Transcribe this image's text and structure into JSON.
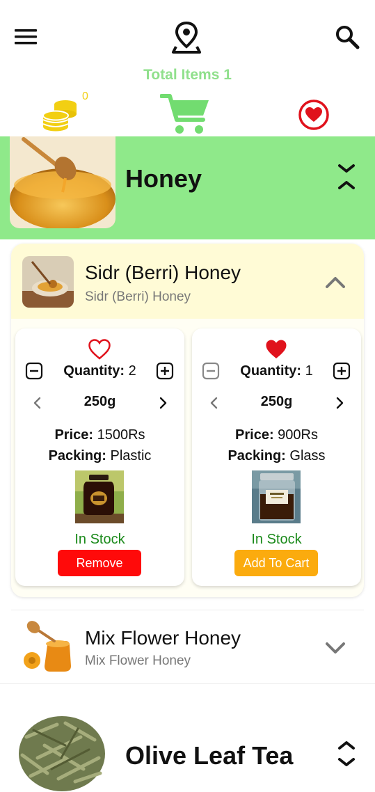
{
  "header": {
    "menu_icon": "hamburger-icon",
    "location_icon": "map-pin-icon",
    "search_icon": "search-icon"
  },
  "summary": {
    "total_items": "Total Items 1",
    "coins_count": "0",
    "coins_icon": "coins-icon",
    "cart_icon": "cart-icon",
    "favorites_icon": "heart-circle-icon"
  },
  "category_expanded": {
    "title": "Honey",
    "band_color": "#8fe98a",
    "toggle_icon": "collapse-chevrons-icon"
  },
  "product_expanded": {
    "name": "Sidr (Berri) Honey",
    "subtitle": "Sidr (Berri) Honey",
    "toggle_icon": "chevron-up-icon",
    "variants": [
      {
        "favorite": false,
        "quantity_label": "Quantity:",
        "quantity_value": "2",
        "size": "250g",
        "price_label": "Price:",
        "price_value": "1500Rs",
        "packing_label": "Packing:",
        "packing_value": "Plastic",
        "stock": "In Stock",
        "action": "Remove",
        "action_color": "#ff0a0a"
      },
      {
        "favorite": true,
        "quantity_label": "Quantity:",
        "quantity_value": "1",
        "size": "250g",
        "price_label": "Price:",
        "price_value": "900Rs",
        "packing_label": "Packing:",
        "packing_value": "Glass",
        "stock": "In Stock",
        "action": "Add To Cart",
        "action_color": "#fbab0e"
      }
    ]
  },
  "product_collapsed": {
    "name": "Mix Flower Honey",
    "subtitle": "Mix Flower Honey",
    "toggle_icon": "chevron-down-icon"
  },
  "category_collapsed": {
    "title": "Olive Leaf Tea",
    "toggle_icon": "expand-chevrons-icon"
  },
  "colors": {
    "accent_green": "#90e08c",
    "heart_red": "#e0121c",
    "stock_green": "#1b8a1b",
    "coin_yellow": "#f2cf13"
  }
}
